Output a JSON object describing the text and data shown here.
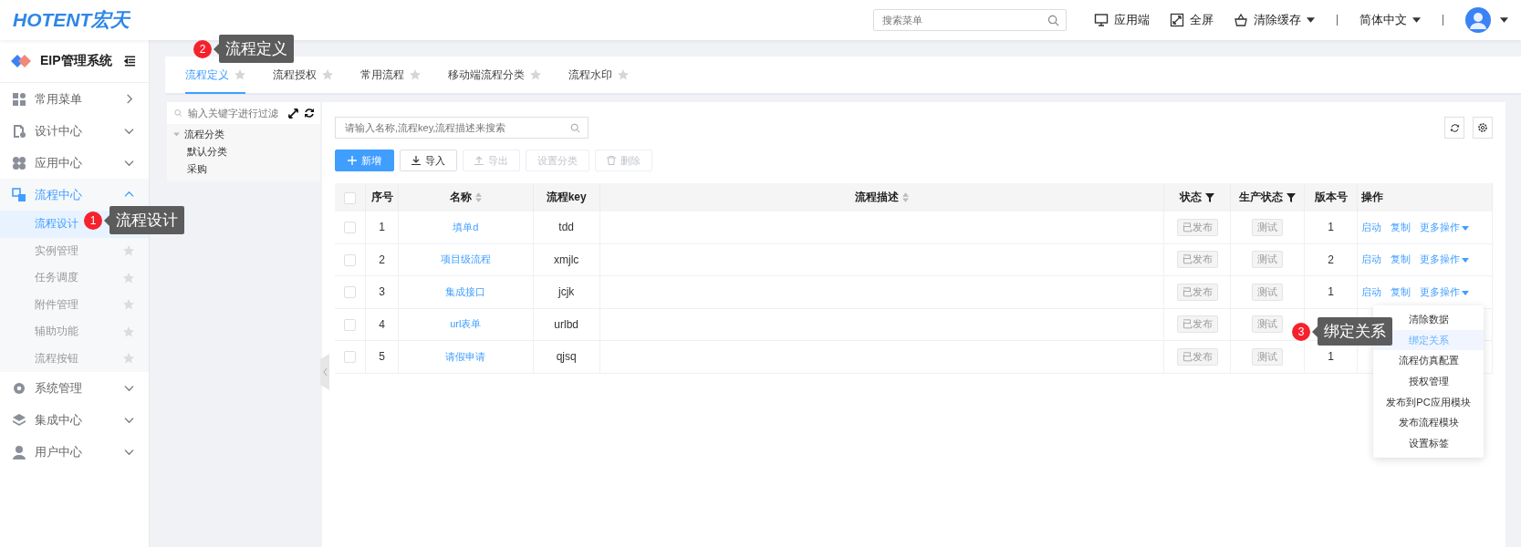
{
  "header": {
    "logo": "HOTENT宏天",
    "search": {
      "placeholder": "搜索菜单"
    },
    "actions": [
      {
        "kind": "monitor",
        "label": "应用端"
      },
      {
        "kind": "fullscreen",
        "label": "全屏"
      },
      {
        "kind": "basket",
        "label": "清除缓存",
        "dropdown": true
      }
    ],
    "language": "简体中文"
  },
  "sidebar": {
    "title": "EIP管理系统",
    "items": [
      {
        "kind": "grid",
        "label": "常用菜单",
        "expanded": false,
        "flyout": true
      },
      {
        "kind": "doc",
        "label": "设计中心",
        "expanded": false,
        "flyout": false
      },
      {
        "kind": "apps",
        "label": "应用中心",
        "expanded": false,
        "flyout": false
      },
      {
        "kind": "flow",
        "label": "流程中心",
        "expanded": true,
        "flyout": false,
        "children": [
          {
            "label": "流程设计",
            "selected": true
          },
          {
            "label": "实例管理",
            "selected": false
          },
          {
            "label": "任务调度",
            "selected": false
          },
          {
            "label": "附件管理",
            "selected": false
          },
          {
            "label": "辅助功能",
            "selected": false
          },
          {
            "label": "流程按钮",
            "selected": false
          }
        ]
      },
      {
        "kind": "gear",
        "label": "系统管理",
        "expanded": false,
        "flyout": false
      },
      {
        "kind": "layers",
        "label": "集成中心",
        "expanded": false,
        "flyout": false
      },
      {
        "kind": "user",
        "label": "用户中心",
        "expanded": false,
        "flyout": false
      }
    ]
  },
  "tabs": [
    {
      "label": "流程定义",
      "selected": true
    },
    {
      "label": "流程授权",
      "selected": false
    },
    {
      "label": "常用流程",
      "selected": false
    },
    {
      "label": "移动端流程分类",
      "selected": false
    },
    {
      "label": "流程水印",
      "selected": false
    }
  ],
  "tree": {
    "filter": {
      "placeholder": "输入关键字进行过滤"
    },
    "nodes": [
      {
        "label": "流程分类",
        "expanded": true,
        "children": [
          {
            "label": "默认分类"
          },
          {
            "label": "采购"
          }
        ]
      }
    ]
  },
  "list": {
    "search": {
      "placeholder": "请输入名称,流程key,流程描述来搜索"
    },
    "buttons": [
      {
        "kind": "add",
        "label": "新增",
        "primary": true,
        "disabled": false
      },
      {
        "kind": "import",
        "label": "导入",
        "primary": false,
        "disabled": false
      },
      {
        "kind": "export",
        "label": "导出",
        "primary": false,
        "disabled": true
      },
      {
        "kind": "plain",
        "label": "设置分类",
        "primary": false,
        "disabled": true
      },
      {
        "kind": "delete",
        "label": "删除",
        "primary": false,
        "disabled": true
      }
    ],
    "table": {
      "all_checked": false,
      "columns": [
        {
          "label": "序号",
          "sortable": false,
          "filterable": false
        },
        {
          "label": "名称",
          "sortable": true,
          "filterable": false
        },
        {
          "label": "流程key",
          "sortable": false,
          "filterable": false
        },
        {
          "label": "流程描述",
          "sortable": true,
          "filterable": false
        },
        {
          "label": "状态",
          "sortable": false,
          "filterable": true
        },
        {
          "label": "生产状态",
          "sortable": false,
          "filterable": true
        },
        {
          "label": "版本号",
          "sortable": false,
          "filterable": false
        },
        {
          "label": "操作",
          "sortable": false,
          "filterable": false
        }
      ],
      "rows": [
        {
          "checked": false,
          "index": "1",
          "name": "填单d",
          "key": "tdd",
          "status": "已发布",
          "production": "测试",
          "version": "1",
          "actions": [
            "启动",
            "复制",
            "更多操作"
          ]
        },
        {
          "checked": false,
          "index": "2",
          "name": "项目级流程",
          "key": "xmjlc",
          "status": "已发布",
          "production": "测试",
          "version": "2",
          "actions": [
            "启动",
            "复制",
            "更多操作"
          ]
        },
        {
          "checked": false,
          "index": "3",
          "name": "集成接口",
          "key": "jcjk",
          "status": "已发布",
          "production": "测试",
          "version": "1",
          "actions": [
            "启动",
            "复制",
            "更多操作"
          ]
        },
        {
          "checked": false,
          "index": "4",
          "name": "url表单",
          "key": "urlbd",
          "status": "已发布",
          "production": "测试"
        },
        {
          "checked": false,
          "index": "5",
          "name": "请假申请",
          "key": "qjsq",
          "status": "已发布",
          "production": "测试",
          "version": "1"
        }
      ],
      "dropdown": [
        {
          "label": "清除数据",
          "selected": false
        },
        {
          "label": "绑定关系",
          "selected": true
        },
        {
          "label": "流程仿真配置",
          "selected": false
        },
        {
          "label": "授权管理",
          "selected": false
        },
        {
          "label": "发布到PC应用模块",
          "selected": false
        },
        {
          "label": "发布流程模块",
          "selected": false
        },
        {
          "label": "设置标签",
          "selected": false
        }
      ]
    }
  },
  "callouts": [
    {
      "number": "1",
      "label": "流程设计"
    },
    {
      "number": "2",
      "label": "流程定义"
    },
    {
      "number": "3",
      "label": "绑定关系"
    }
  ]
}
